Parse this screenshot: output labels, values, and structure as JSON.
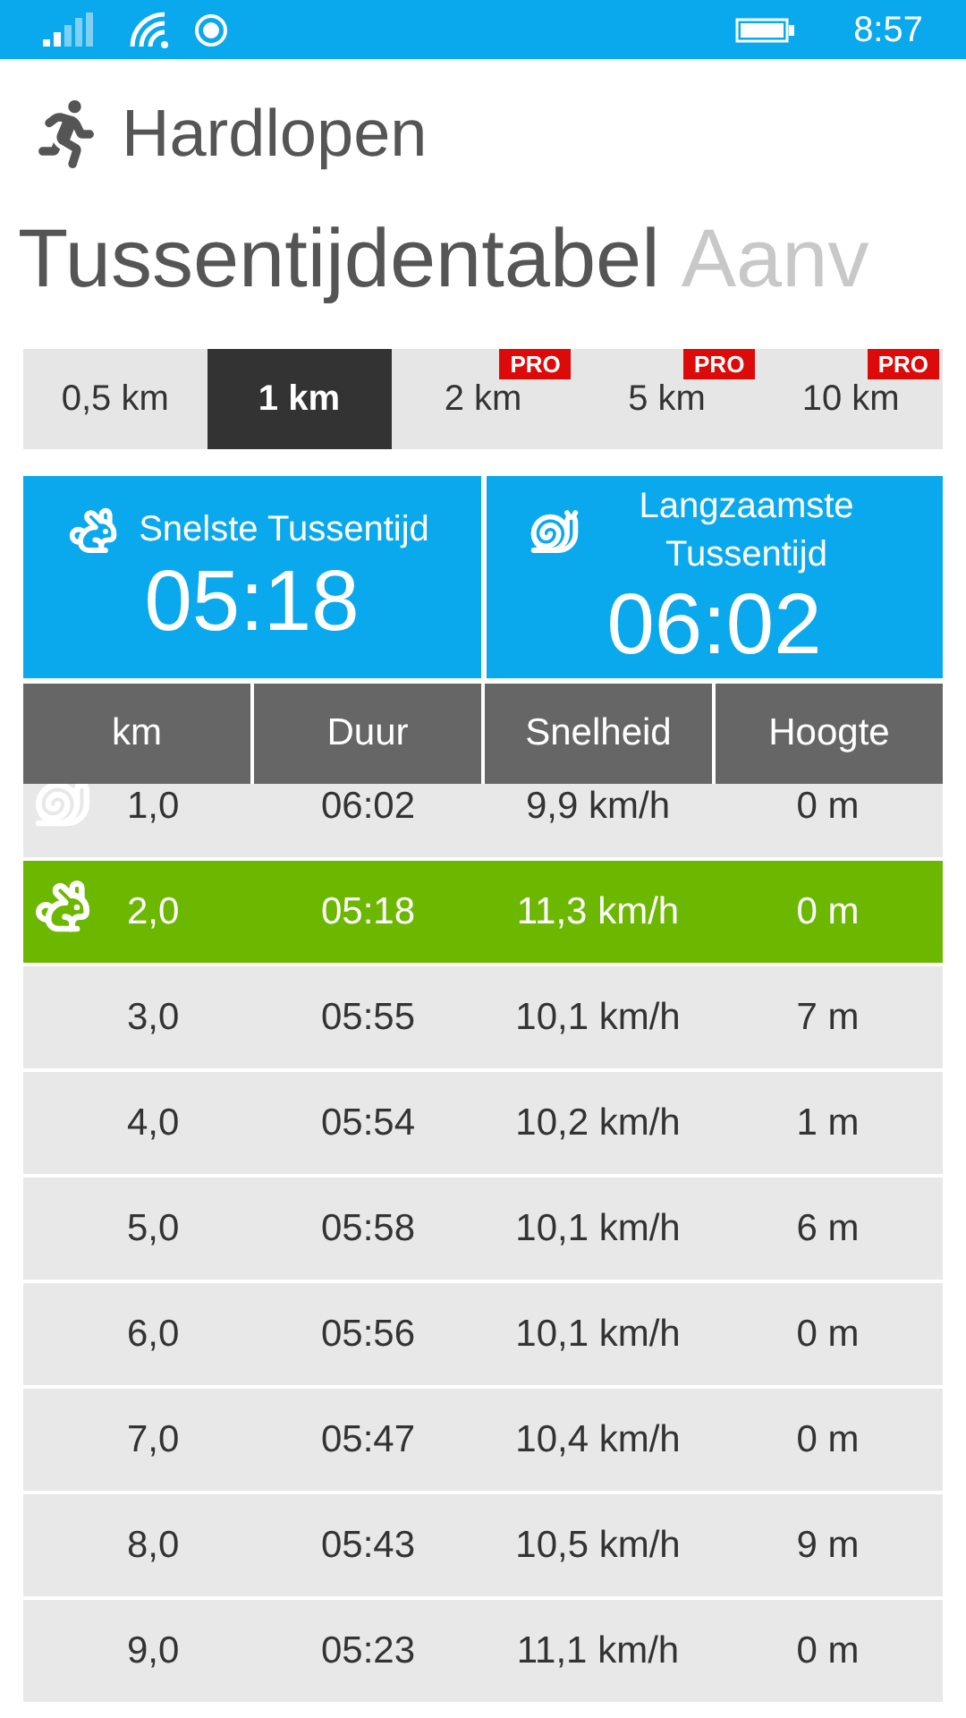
{
  "status_bar": {
    "time": "8:57"
  },
  "app": {
    "title": "Hardlopen"
  },
  "pivot": [
    {
      "label": "Tussentijdentabel",
      "selected": true
    },
    {
      "label": "Aanv",
      "selected": false
    }
  ],
  "distance_tabs": [
    {
      "label": "0,5 km",
      "selected": false
    },
    {
      "label": "1 km",
      "selected": true
    },
    {
      "label": "2 km",
      "selected": false,
      "badge": "PRO"
    },
    {
      "label": "5 km",
      "selected": false,
      "badge": "PRO"
    },
    {
      "label": "10 km",
      "selected": false,
      "badge": "PRO"
    }
  ],
  "summary": [
    {
      "kind": "fastest",
      "label": "Snelste Tussentijd",
      "time": "05:18"
    },
    {
      "kind": "slowest",
      "label": "Langzaamste Tussentijd",
      "time": "06:02"
    }
  ],
  "table": {
    "columns": [
      "km",
      "Duur",
      "Snelheid",
      "Hoogte"
    ],
    "rows": [
      {
        "kind": "slowest",
        "cells": [
          "1,0",
          "06:02",
          "9,9 km/h",
          "0 m"
        ]
      },
      {
        "kind": "fastest",
        "cells": [
          "2,0",
          "05:18",
          "11,3 km/h",
          "0 m"
        ]
      },
      {
        "kind": "plain",
        "cells": [
          "3,0",
          "05:55",
          "10,1 km/h",
          "7 m"
        ]
      },
      {
        "kind": "plain",
        "cells": [
          "4,0",
          "05:54",
          "10,2 km/h",
          "1 m"
        ]
      },
      {
        "kind": "plain",
        "cells": [
          "5,0",
          "05:58",
          "10,1 km/h",
          "6 m"
        ]
      },
      {
        "kind": "plain",
        "cells": [
          "6,0",
          "05:56",
          "10,1 km/h",
          "0 m"
        ]
      },
      {
        "kind": "plain",
        "cells": [
          "7,0",
          "05:47",
          "10,4 km/h",
          "0 m"
        ]
      },
      {
        "kind": "plain",
        "cells": [
          "8,0",
          "05:43",
          "10,5 km/h",
          "9 m"
        ]
      },
      {
        "kind": "plain",
        "cells": [
          "9,0",
          "05:23",
          "11,1 km/h",
          "0 m"
        ]
      }
    ]
  }
}
